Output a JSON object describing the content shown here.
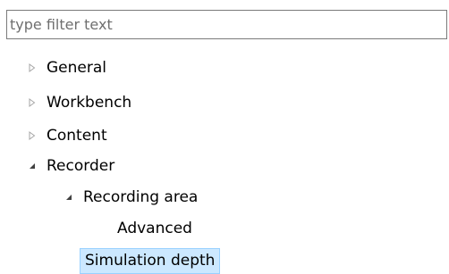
{
  "filter": {
    "placeholder": "type filter text",
    "value": ""
  },
  "tree": {
    "items": [
      {
        "label": "General",
        "state": "collapsed"
      },
      {
        "label": "Workbench",
        "state": "collapsed"
      },
      {
        "label": "Content",
        "state": "collapsed"
      },
      {
        "label": "Recorder",
        "state": "expanded"
      },
      {
        "label": "Recording area",
        "state": "expanded"
      },
      {
        "label": "Advanced",
        "state": "leaf"
      },
      {
        "label": "Simulation depth",
        "state": "leaf",
        "selected": true
      }
    ]
  },
  "icons": {
    "collapsed": "triangle-right-outline-icon",
    "expanded": "triangle-down-right-filled-icon"
  },
  "colors": {
    "selection_background": "#cce8ff",
    "selection_border": "#99d1ff",
    "filter_border": "#7a7a7a",
    "placeholder_text": "#6f6f6f"
  }
}
